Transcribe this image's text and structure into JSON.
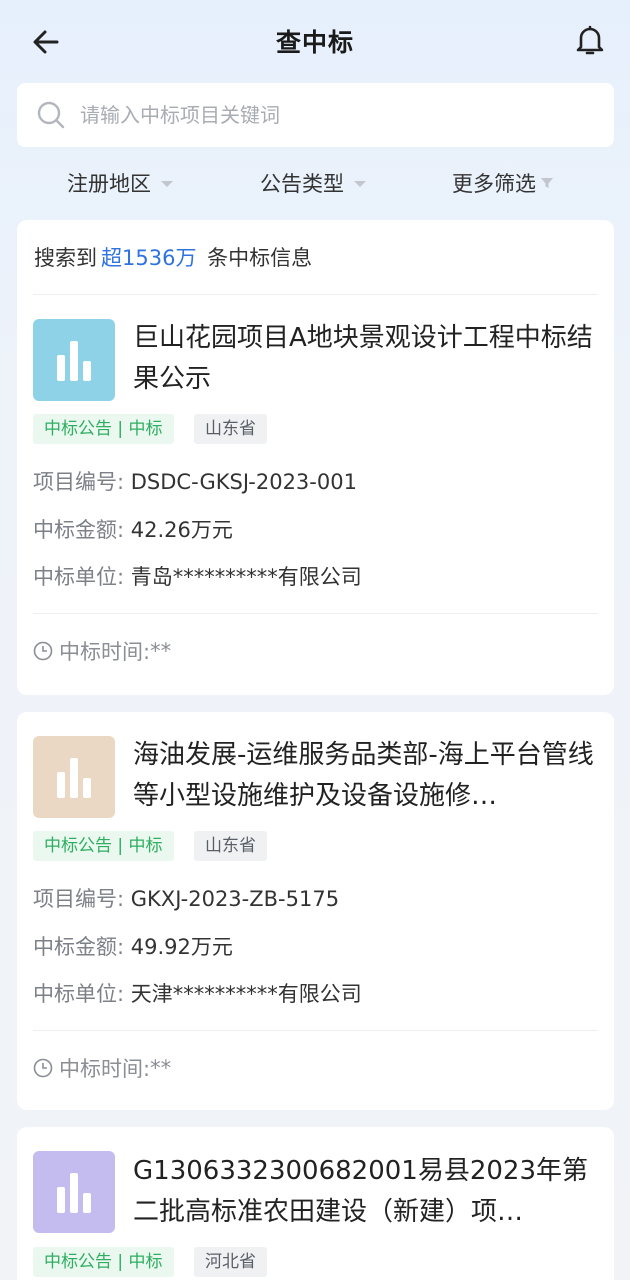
{
  "header": {
    "title": "查中标"
  },
  "search": {
    "placeholder": "请输入中标项目关键词"
  },
  "filters": [
    {
      "label": "注册地区"
    },
    {
      "label": "公告类型"
    },
    {
      "label": "更多筛选"
    }
  ],
  "summary": {
    "prefix": "搜索到",
    "count": "超1536万",
    "suffix": "条中标信息"
  },
  "colors": {
    "accent": "#2f73e0",
    "tag_green": "#2fae62"
  },
  "labels": {
    "project_no": "项目编号: ",
    "amount": "中标金额: ",
    "winner": "中标单位: ",
    "time": "中标时间: "
  },
  "items": [
    {
      "icon": "bar-chart-icon",
      "thumb_color": "#8ed2e8",
      "title": "巨山花园项目A地块景观设计工程中标结果公示",
      "tag": "中标公告 | 中标",
      "region": "山东省",
      "project_no": "DSDC-GKSJ-2023-001",
      "amount": "42.26万元",
      "winner": "青岛**********有限公司",
      "time": "**"
    },
    {
      "icon": "bar-chart-icon",
      "thumb_color": "#ead8c4",
      "title": "海油发展-运维服务品类部-海上平台管线等小型设施维护及设备设施修…",
      "tag": "中标公告 | 中标",
      "region": "山东省",
      "project_no": "GKXJ-2023-ZB-5175",
      "amount": "49.92万元",
      "winner": "天津**********有限公司",
      "time": "**"
    },
    {
      "icon": "bar-chart-icon",
      "thumb_color": "#c4bbee",
      "title": "G1306332300682001易县2023年第二批高标准农田建设（新建）项…",
      "tag": "中标公告 | 中标",
      "region": "河北省"
    }
  ]
}
